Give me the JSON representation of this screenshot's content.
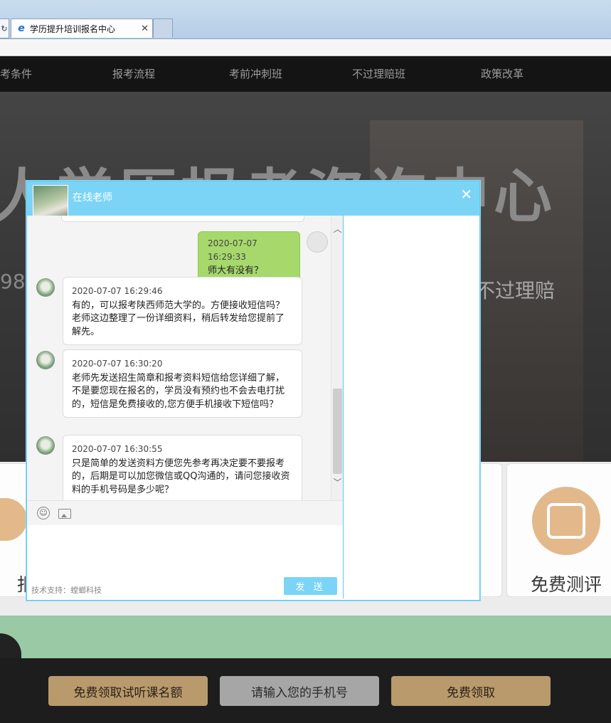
{
  "browser": {
    "tab_title": "学历提升培训报名中心",
    "reload_glyph": "↻",
    "close_glyph": "✕",
    "ie_glyph": "e"
  },
  "nav": {
    "items": [
      "考条件",
      "报考流程",
      "考前冲刺班",
      "不过理赔班",
      "政策改革"
    ]
  },
  "hero": {
    "title": "人学历报考咨询中心",
    "left_text": "980",
    "right_text": "  不过理赔"
  },
  "cards": {
    "left_label": "报",
    "right_label": "免费测评"
  },
  "footer": {
    "btn1": "免费领取试听课名额",
    "btn2": "请输入您的手机号",
    "btn3": "免费领取"
  },
  "dialog": {
    "title": "在线老师",
    "close": "✕",
    "messages": [
      {
        "role": "user",
        "time": "2020-07-07 16:29:33",
        "text": "师大有没有？"
      },
      {
        "role": "agent",
        "time": "2020-07-07 16:29:46",
        "text": "有的，可以报考陕西师范大学的。方便接收短信吗？老师这边整理了一份详细资料，稍后转发给您提前了解先。"
      },
      {
        "role": "agent",
        "time": "2020-07-07 16:30:20",
        "text": "老师先发送招生简章和报考资料短信给您详细了解，不是要您现在报名的，学员没有预约也不会去电打扰的，短信是免费接收的,您方便手机接收下短信吗？"
      },
      {
        "role": "agent",
        "time": "2020-07-07 16:30:55",
        "text": "只是简单的发送资料方便您先参考再决定要不要报考的，后期是可以加您微信或QQ沟通的，请问您接收资料的手机号码是多少呢？"
      }
    ],
    "support": "技术支持：螳螂科技",
    "send": "发 送",
    "scroll_up": "︿",
    "scroll_down": "﹀"
  }
}
